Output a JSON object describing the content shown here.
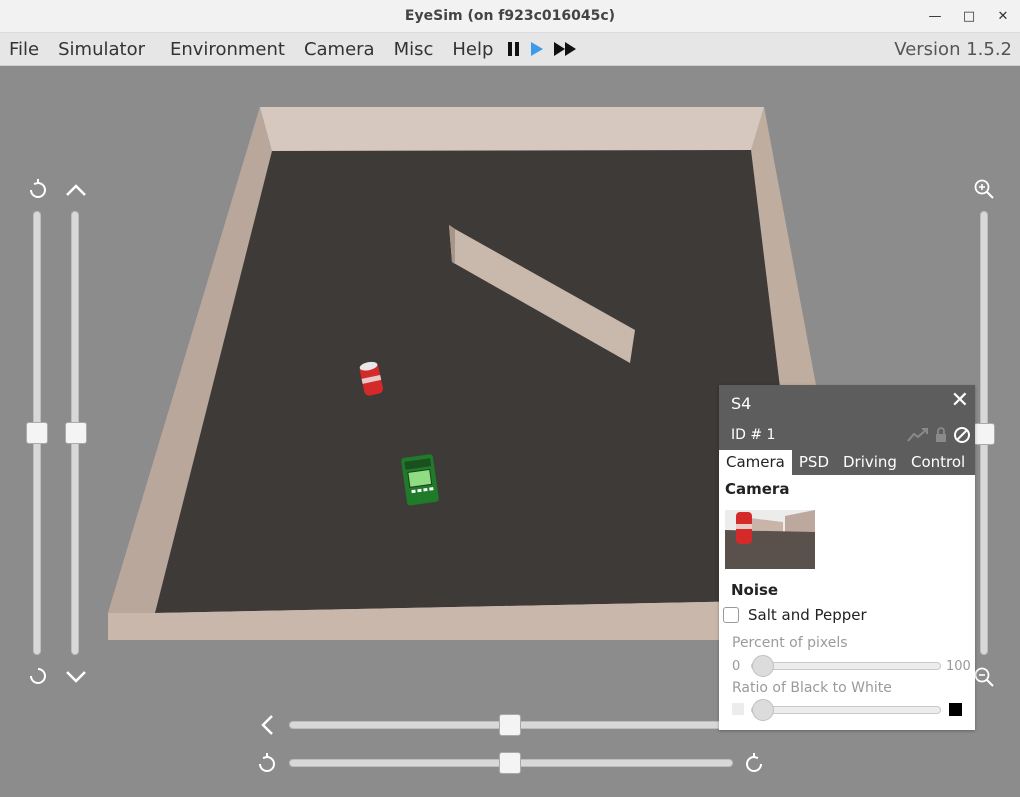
{
  "window": {
    "title": "EyeSim (on f923c016045c)"
  },
  "menu": {
    "items": [
      "File",
      "Simulator",
      "Environment",
      "Camera",
      "Misc",
      "Help"
    ],
    "version": "Version 1.5.2"
  },
  "icons": {
    "pause": "pause-icon",
    "play": "play-icon",
    "fast_forward": "fast-forward-icon",
    "rotate_ccw": "rotate-ccw-icon",
    "rotate_cw": "rotate-cw-icon",
    "chevron_up": "chevron-up-icon",
    "chevron_down": "chevron-down-icon",
    "zoom_in": "zoom-in-icon",
    "zoom_out": "zoom-out-icon"
  },
  "robot_panel": {
    "name": "S4",
    "id_label": "ID # 1",
    "tabs": [
      "Camera",
      "PSD",
      "Driving",
      "Control"
    ],
    "active_tab": "Camera",
    "camera_title": "Camera",
    "noise_title": "Noise",
    "salt_pepper_label": "Salt and Pepper",
    "salt_pepper_checked": false,
    "percent_label": "Percent of pixels",
    "percent_min": "0",
    "percent_max": "100",
    "percent_value": 0,
    "ratio_label": "Ratio of Black to White",
    "ratio_value": 0
  },
  "colors": {
    "accent_play": "#3b9be8",
    "panel_header": "#5d5d5d",
    "floor": "#3d3a38",
    "wall": "#c4b2a6"
  }
}
